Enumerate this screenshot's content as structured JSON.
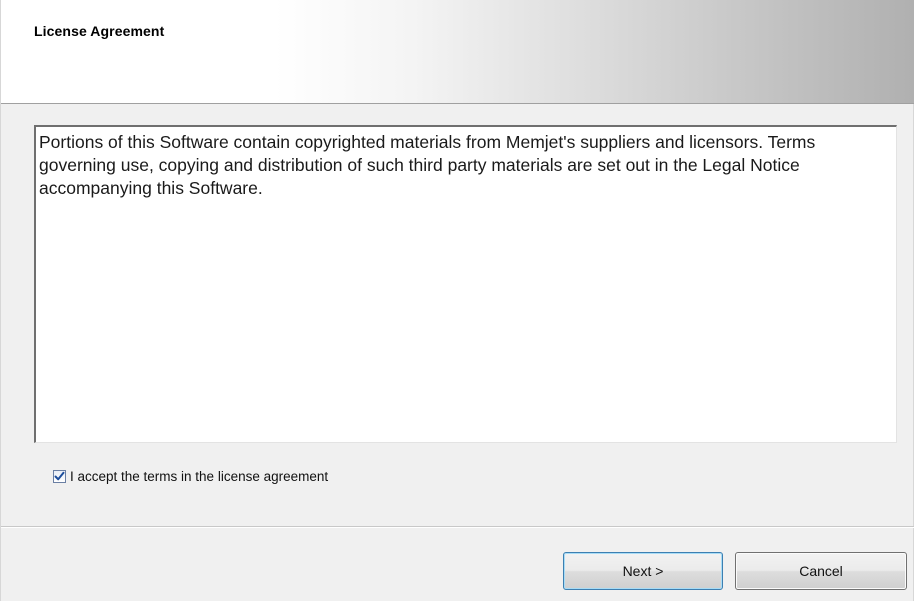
{
  "header": {
    "title": "License Agreement"
  },
  "license": {
    "text": "Portions of this Software contain copyrighted materials from Memjet's suppliers and licensors. Terms governing use, copying and distribution of such third party materials are set out in the Legal Notice accompanying this Software."
  },
  "accept": {
    "checked": true,
    "label": "I accept the terms in the license agreement"
  },
  "buttons": {
    "next_label": "Next >",
    "cancel_label": "Cancel"
  }
}
